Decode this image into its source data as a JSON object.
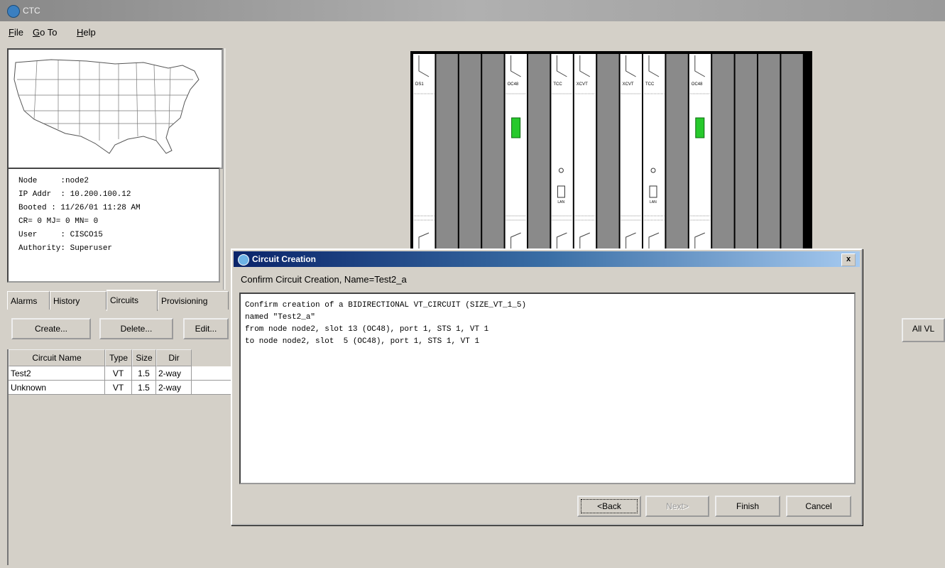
{
  "window": {
    "title": "CTC"
  },
  "menu": {
    "items": [
      "File",
      "Go To",
      "Help"
    ]
  },
  "node_info": {
    "lines": [
      "Node     :node2",
      "IP Addr  : 10.200.100.12",
      "Booted : 11/26/01 11:28 AM",
      "CR= 0 MJ= 0 MN= 0",
      "User     : CISCO15",
      "Authority: Superuser"
    ]
  },
  "shelf": {
    "card_labels": [
      "DS1",
      "OC48",
      "TCC",
      "XCVT",
      "XCVT",
      "TCC",
      "OC48"
    ],
    "lan_label": "LAN",
    "status_colors": {
      "active": "#27c92c",
      "slot_empty": "#8a8a8a",
      "card": "#ffffff"
    }
  },
  "tabs": [
    "Alarms",
    "History",
    "Circuits",
    "Provisioning"
  ],
  "toolbar": {
    "create": "Create...",
    "delete": "Delete...",
    "edit": "Edit...",
    "all_vb": "All VL"
  },
  "circuits_table": {
    "headers": [
      "Circuit Name",
      "Type",
      "Size",
      "Dir"
    ],
    "rows": [
      [
        "Test2",
        "VT",
        "1.5",
        "2-way"
      ],
      [
        "Unknown",
        "VT",
        "1.5",
        "2-way"
      ]
    ]
  },
  "dialog": {
    "title": "Circuit Creation",
    "subtitle": "Confirm Circuit Creation, Name=Test2_a",
    "body": [
      "Confirm creation of a BIDIRECTIONAL VT_CIRCUIT (SIZE_VT_1_5)",
      "named \"Test2_a\"",
      "from node node2, slot 13 (OC48), port 1, STS 1, VT 1",
      "to node node2, slot  5 (OC48), port 1, STS 1, VT 1"
    ],
    "buttons": {
      "back": "<Back",
      "next": "Next>",
      "finish": "Finish",
      "cancel": "Cancel"
    },
    "close_glyph": "x"
  }
}
